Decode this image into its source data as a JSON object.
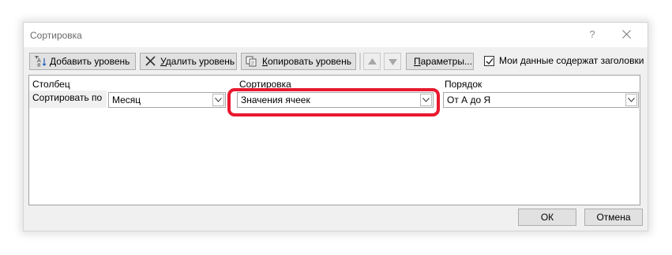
{
  "window": {
    "title": "Сортировка",
    "help_label": "?"
  },
  "toolbar": {
    "add_level": {
      "underlined": "Д",
      "rest": "обавить уровень"
    },
    "delete_level": {
      "underlined": "У",
      "rest": "далить уровень"
    },
    "copy_level": {
      "underlined": "К",
      "rest": "опировать уровень"
    },
    "options": {
      "underlined": "П",
      "rest": "араметры..."
    },
    "move_up_icon": "triangle-up",
    "move_down_icon": "triangle-down"
  },
  "headers_checkbox": {
    "checked": true,
    "label": "Мои данные содержат заголовки"
  },
  "grid": {
    "columns": [
      "Столбец",
      "Сортировка",
      "Порядок"
    ],
    "row": {
      "label": "Сортировать по",
      "column_value": "Месяц",
      "sort_on_value": "Значения ячеек",
      "order_value": "От А до Я"
    }
  },
  "footer": {
    "ok_label": "ОК",
    "cancel_label": "Отмена"
  },
  "colors": {
    "highlight": "#e8182e",
    "dialog_bg": "#f0f0f0",
    "button_bg": "#e1e1e1"
  }
}
